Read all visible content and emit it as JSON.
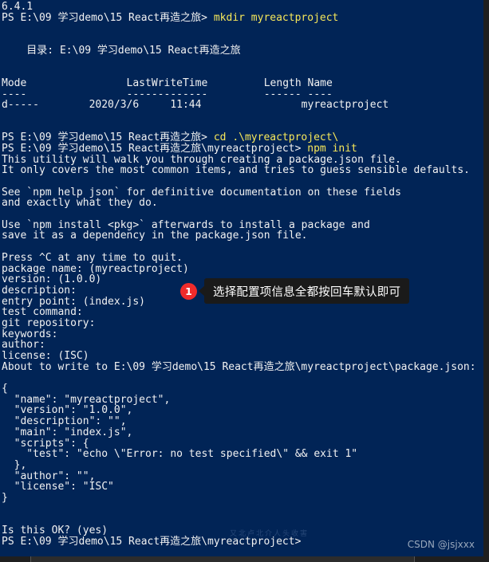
{
  "terminal": {
    "background_color": "#012456",
    "text_color": "#f2f2f2",
    "command_color": "#f7e85a",
    "lines": [
      {
        "id": "l0",
        "text": "6.4.1"
      },
      {
        "id": "l1",
        "text": "PS E:\\09 学习demo\\15 React再造之旅> ",
        "cmd": "mkdir myreactproject"
      },
      {
        "id": "l2",
        "text": ""
      },
      {
        "id": "l3",
        "text": ""
      },
      {
        "id": "l4",
        "text": "    目录: E:\\09 学习demo\\15 React再造之旅"
      },
      {
        "id": "l5",
        "text": ""
      },
      {
        "id": "l6",
        "text": ""
      },
      {
        "id": "l7",
        "text": "Mode                LastWriteTime         Length Name"
      },
      {
        "id": "l8",
        "text": "----                -------------         ------ ----"
      },
      {
        "id": "l9",
        "text": "d-----        2020/3/6     11:44                myreactproject"
      },
      {
        "id": "l10",
        "text": ""
      },
      {
        "id": "l11",
        "text": ""
      },
      {
        "id": "l12",
        "text": "PS E:\\09 学习demo\\15 React再造之旅> ",
        "cmd": "cd .\\myreactproject\\"
      },
      {
        "id": "l13",
        "text": "PS E:\\09 学习demo\\15 React再造之旅\\myreactproject> ",
        "cmd": "npm init"
      },
      {
        "id": "l14",
        "text": "This utility will walk you through creating a package.json file."
      },
      {
        "id": "l15",
        "text": "It only covers the most common items, and tries to guess sensible defaults."
      },
      {
        "id": "l16",
        "text": ""
      },
      {
        "id": "l17",
        "text": "See `npm help json` for definitive documentation on these fields"
      },
      {
        "id": "l18",
        "text": "and exactly what they do."
      },
      {
        "id": "l19",
        "text": ""
      },
      {
        "id": "l20",
        "text": "Use `npm install <pkg>` afterwards to install a package and"
      },
      {
        "id": "l21",
        "text": "save it as a dependency in the package.json file."
      },
      {
        "id": "l22",
        "text": ""
      },
      {
        "id": "l23",
        "text": "Press ^C at any time to quit."
      },
      {
        "id": "l24",
        "text": "package name: (myreactproject)"
      },
      {
        "id": "l25",
        "text": "version: (1.0.0)"
      },
      {
        "id": "l26",
        "text": "description:"
      },
      {
        "id": "l27",
        "text": "entry point: (index.js)"
      },
      {
        "id": "l28",
        "text": "test command:"
      },
      {
        "id": "l29",
        "text": "git repository:"
      },
      {
        "id": "l30",
        "text": "keywords:"
      },
      {
        "id": "l31",
        "text": "author:"
      },
      {
        "id": "l32",
        "text": "license: (ISC)"
      },
      {
        "id": "l33",
        "text": "About to write to E:\\09 学习demo\\15 React再造之旅\\myreactproject\\package.json:"
      },
      {
        "id": "l34",
        "text": ""
      },
      {
        "id": "l35",
        "text": "{"
      },
      {
        "id": "l36",
        "text": "  \"name\": \"myreactproject\","
      },
      {
        "id": "l37",
        "text": "  \"version\": \"1.0.0\","
      },
      {
        "id": "l38",
        "text": "  \"description\": \"\","
      },
      {
        "id": "l39",
        "text": "  \"main\": \"index.js\","
      },
      {
        "id": "l40",
        "text": "  \"scripts\": {"
      },
      {
        "id": "l41",
        "text": "    \"test\": \"echo \\\"Error: no test specified\\\" && exit 1\""
      },
      {
        "id": "l42",
        "text": "  },"
      },
      {
        "id": "l43",
        "text": "  \"author\": \"\","
      },
      {
        "id": "l44",
        "text": "  \"license\": \"ISC\""
      },
      {
        "id": "l45",
        "text": "}"
      },
      {
        "id": "l46",
        "text": ""
      },
      {
        "id": "l47",
        "text": ""
      },
      {
        "id": "l48",
        "text": "Is this OK? (yes)"
      },
      {
        "id": "l49",
        "text": "PS E:\\09 学习demo\\15 React再造之旅\\myreactproject>"
      }
    ]
  },
  "annotation": {
    "badge_number": "1",
    "badge_color": "#f02b2b",
    "text": "选择配置项信息全都按回车默认即可",
    "background_color": "#1a1a1a"
  },
  "watermarks": {
    "csdn": "CSDN @jsjxxx",
    "center": "又北卢北介人头收害"
  }
}
